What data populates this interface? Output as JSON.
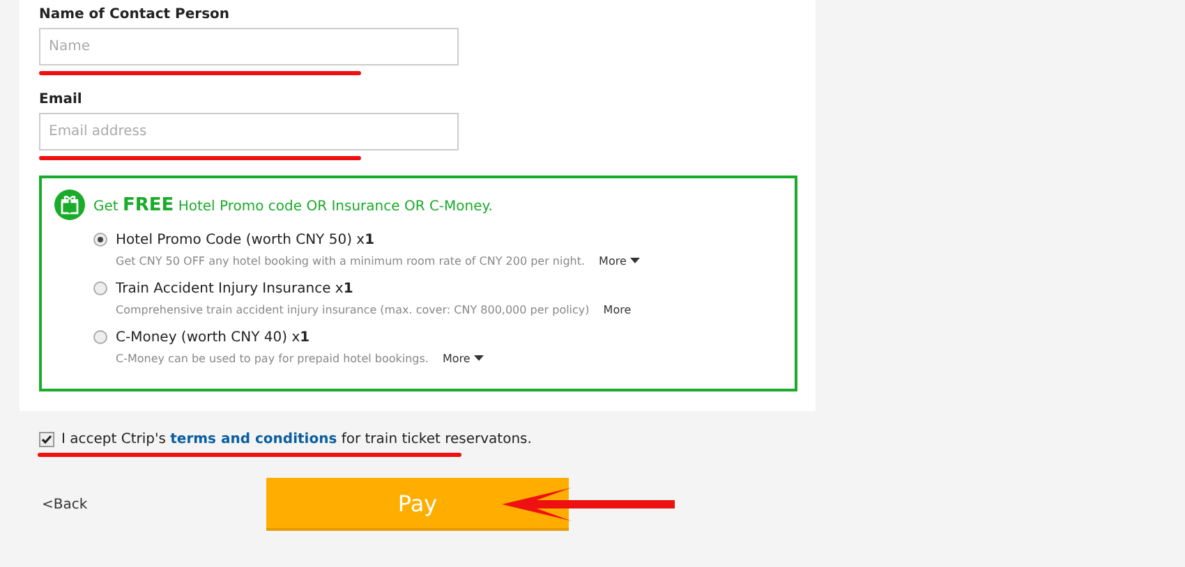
{
  "contact": {
    "label": "Name of Contact Person",
    "placeholder": "Name"
  },
  "email": {
    "label": "Email",
    "placeholder": "Email address"
  },
  "promo": {
    "title": "Get **FREE** Hotel Promo code OR Insurance OR C-Money.",
    "options": [
      {
        "label": "Hotel Promo Code (worth CNY 50) x**1**",
        "description": "Get CNY 50 OFF any hotel booking with a minimum room rate of CNY 200 per night.",
        "more": "More",
        "more_caret": true,
        "selected": true
      },
      {
        "label": "Train Accident Injury Insurance x**1**",
        "description": "Comprehensive train accident injury insurance (max. cover: CNY 800,000 per policy)",
        "more": "More",
        "more_caret": false,
        "selected": false
      },
      {
        "label": "C-Money (worth CNY 40) x**1**",
        "description": "C-Money can be used to pay for prepaid hotel bookings.",
        "more": "More",
        "more_caret": true,
        "selected": false
      }
    ]
  },
  "terms": {
    "checked": true,
    "before": "I accept Ctrip's",
    "link": "terms and conditions",
    "after": "for train ticket reservatons."
  },
  "back": "<Back",
  "pay": "Pay"
}
